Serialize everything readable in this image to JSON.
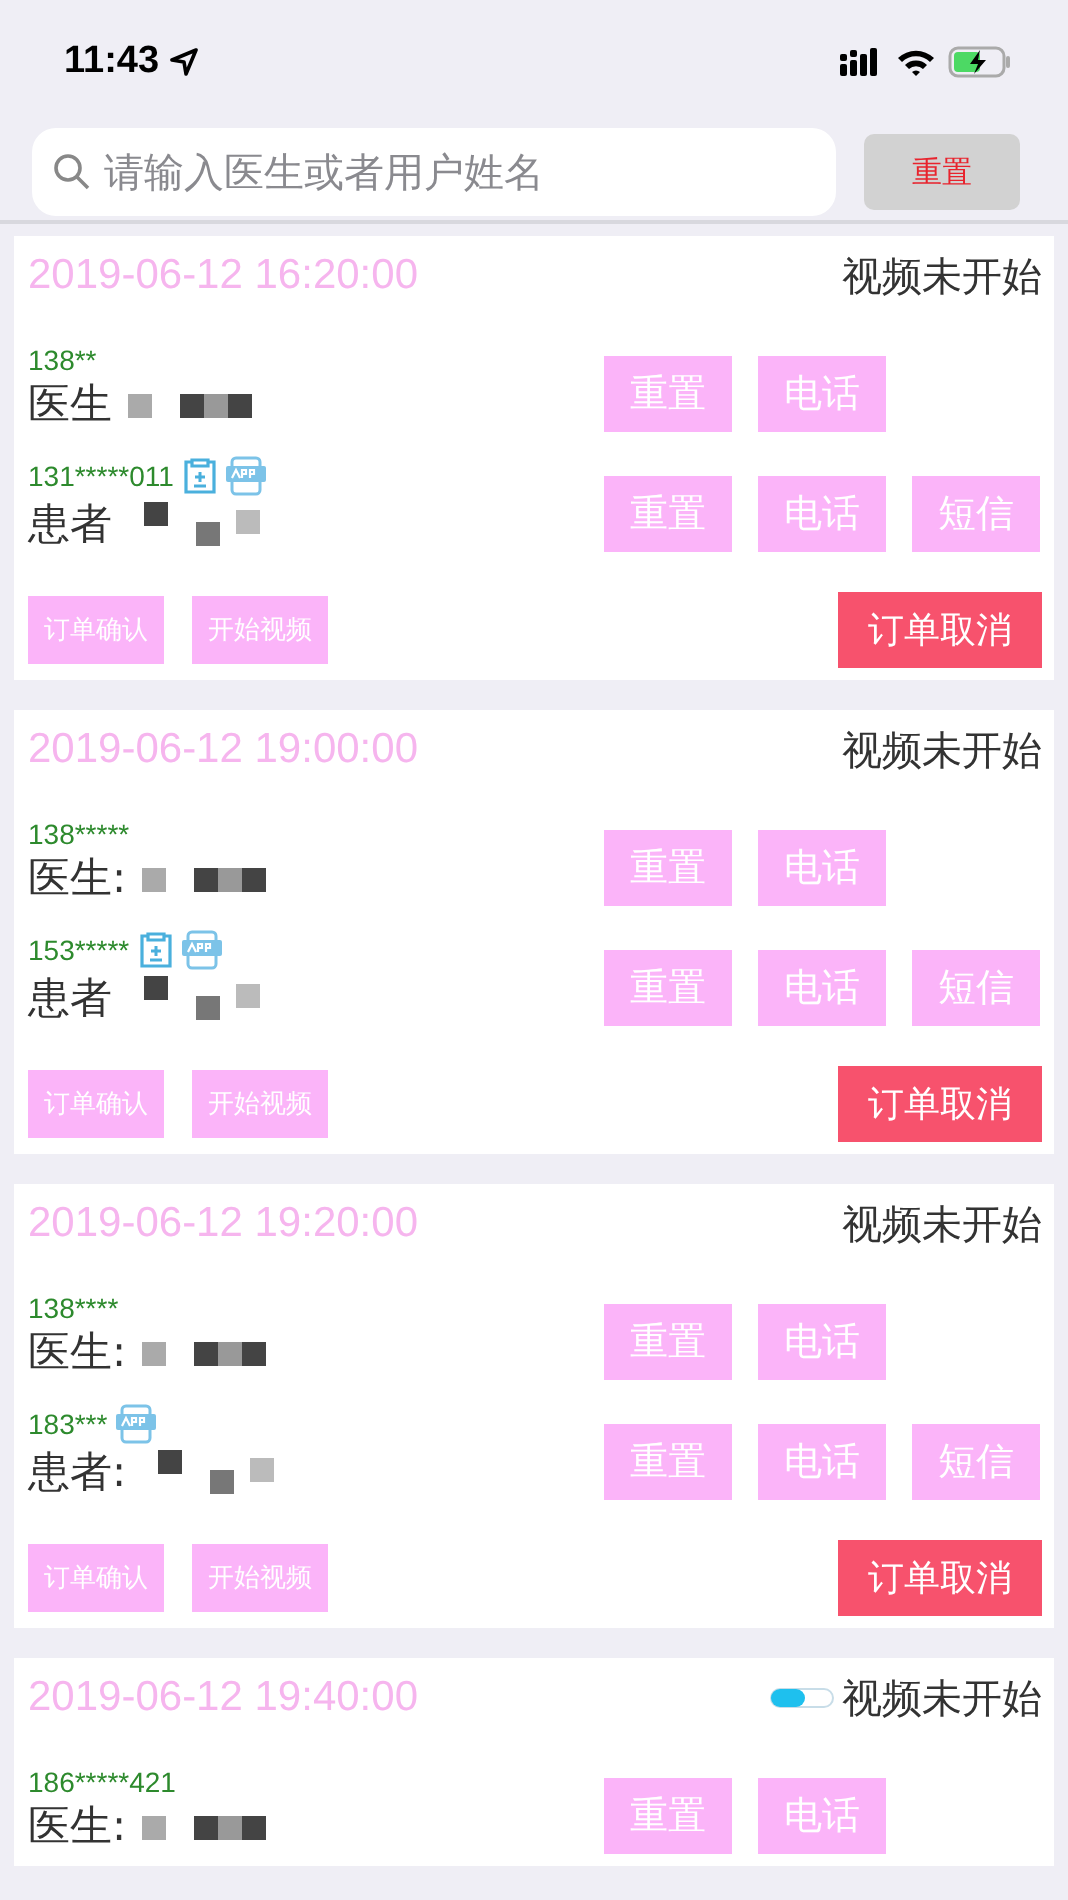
{
  "status_bar": {
    "time": "11:43"
  },
  "search": {
    "placeholder": "请输入医生或者用户姓名",
    "reset_button": "重置"
  },
  "orders": [
    {
      "time": "2019-06-12 16:20:00",
      "status": "视频未开始",
      "indicator": false,
      "doctor": {
        "phone": "138**",
        "label": "医生",
        "buttons": [
          "重置",
          "电话"
        ]
      },
      "patient": {
        "phone": "131*****011",
        "label": "患者",
        "record_icon": true,
        "app_icon": true,
        "buttons": [
          "重置",
          "电话",
          "短信"
        ]
      },
      "actions": {
        "confirm": "订单确认",
        "start_video": "开始视频",
        "cancel": "订单取消"
      }
    },
    {
      "time": "2019-06-12 19:00:00",
      "status": "视频未开始",
      "indicator": false,
      "doctor": {
        "phone": "138*****",
        "label": "医生:",
        "buttons": [
          "重置",
          "电话"
        ]
      },
      "patient": {
        "phone": "153*****",
        "label": "患者",
        "record_icon": true,
        "app_icon": true,
        "buttons": [
          "重置",
          "电话",
          "短信"
        ]
      },
      "actions": {
        "confirm": "订单确认",
        "start_video": "开始视频",
        "cancel": "订单取消"
      }
    },
    {
      "time": "2019-06-12 19:20:00",
      "status": "视频未开始",
      "indicator": false,
      "doctor": {
        "phone": "138****",
        "label": "医生:",
        "buttons": [
          "重置",
          "电话"
        ]
      },
      "patient": {
        "phone": "183***",
        "label": "患者:",
        "record_icon": false,
        "app_icon": true,
        "buttons": [
          "重置",
          "电话",
          "短信"
        ]
      },
      "actions": {
        "confirm": "订单确认",
        "start_video": "开始视频",
        "cancel": "订单取消"
      }
    },
    {
      "time": "2019-06-12 19:40:00",
      "status": "视频未开始",
      "indicator": true,
      "doctor": {
        "phone": "186*****421",
        "label": "医生:",
        "buttons": [
          "重置",
          "电话"
        ]
      }
    }
  ]
}
